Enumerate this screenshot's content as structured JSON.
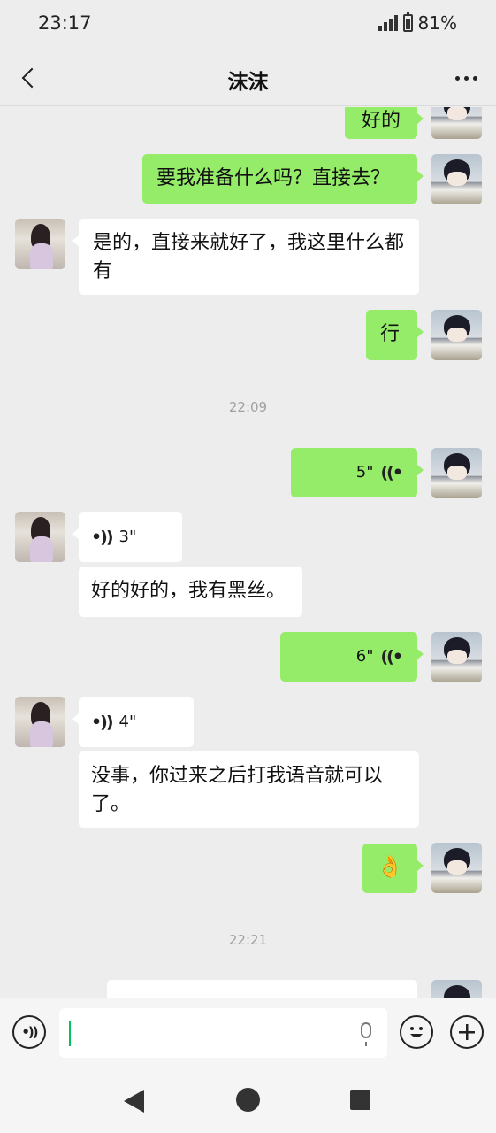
{
  "status_bar": {
    "time": "23:17",
    "battery": "81%"
  },
  "header": {
    "title": "沫沫"
  },
  "messages": {
    "m1": "好的",
    "m2": "要我准备什么吗？直接去？",
    "m3": "是的，直接来就好了，我这里什么都有",
    "m4": "行",
    "time1": "22:09",
    "v1": "5\"",
    "v2": "3\"",
    "m5": "好的好的，我有黑丝。",
    "v3": "6\"",
    "v4": "4\"",
    "m6": "没事，你过来之后打我语音就可以了。",
    "m7": "👌",
    "time2": "22:21"
  },
  "icons": {
    "back": "chevron-left-icon",
    "more": "more-dots-icon",
    "voice": "voice-wave-icon",
    "mic": "microphone-icon",
    "emoji": "emoji-icon",
    "plus": "plus-icon"
  },
  "colors": {
    "my_bubble": "#95ec69",
    "their_bubble": "#ffffff",
    "background": "#ededed",
    "caret": "#07c160"
  }
}
